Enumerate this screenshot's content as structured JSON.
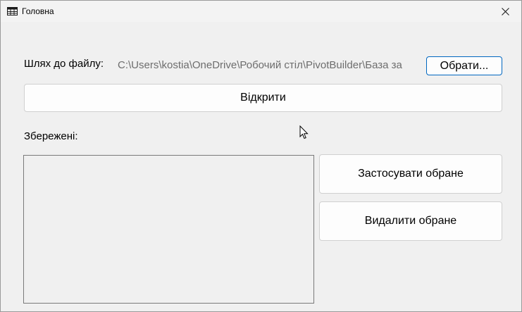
{
  "window": {
    "title": "Головна",
    "icon": "table-grid-icon",
    "close_icon": "close-icon"
  },
  "file": {
    "label": "Шлях до файлу:",
    "path_value": "C:\\Users\\kostia\\OneDrive\\Робочий стіл\\PivotBuilder\\База за",
    "browse_label": "Обрати..."
  },
  "open_label": "Відкрити",
  "saved": {
    "label": "Збережені:",
    "items": []
  },
  "actions": {
    "apply_label": "Застосувати обране",
    "delete_label": "Видалити обране"
  },
  "colors": {
    "accent": "#0067c0",
    "background": "#f0f0f0"
  }
}
